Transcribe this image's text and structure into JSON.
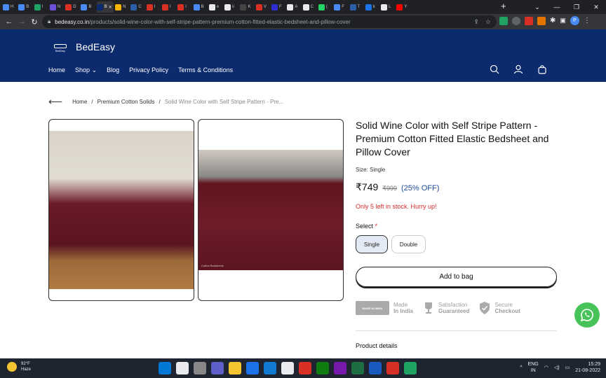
{
  "browser": {
    "tabs": [
      {
        "label": "H",
        "color": "#4a8af4"
      },
      {
        "label": "B",
        "color": "#4a8af4"
      },
      {
        "label": "I",
        "color": "#1ea362"
      },
      {
        "label": "N",
        "color": "#6b4fd8"
      },
      {
        "label": "D",
        "color": "#d93025"
      },
      {
        "label": "B",
        "color": "#4a8af4"
      },
      {
        "label": "B",
        "color": "#0c2a6e",
        "active": true
      },
      {
        "label": "N",
        "color": "#f4b400"
      },
      {
        "label": "C",
        "color": "#2c5fa8"
      },
      {
        "label": "I",
        "color": "#d93025"
      },
      {
        "label": "I",
        "color": "#d93025"
      },
      {
        "label": "I",
        "color": "#d93025"
      },
      {
        "label": "B",
        "color": "#4a8af4"
      },
      {
        "label": "e",
        "color": "#e8eaed"
      },
      {
        "label": "ii",
        "color": "#e8eaed"
      },
      {
        "label": "K",
        "color": "#444"
      },
      {
        "label": "V",
        "color": "#d93025"
      },
      {
        "label": "F",
        "color": "#2c2ccf"
      },
      {
        "label": "A",
        "color": "#e8eaed"
      },
      {
        "label": "C",
        "color": "#e8eaed"
      },
      {
        "label": "(",
        "color": "#25d366"
      },
      {
        "label": "F",
        "color": "#4a8af4"
      },
      {
        "label": "T",
        "color": "#2c5fa8"
      },
      {
        "label": "k",
        "color": "#1a73e8"
      },
      {
        "label": "L",
        "color": "#e8eaed"
      },
      {
        "label": "Y",
        "color": "#ff0000"
      }
    ],
    "new_tab": "+",
    "url_host": "bedeasy.co.in",
    "url_path": "/products/solid-wine-color-with-self-stripe-pattern-premium-cotton-fitted-elastic-bedsheet-and-pillow-cover",
    "profile_initial": "P"
  },
  "site": {
    "brand": "BedEasy",
    "brand_sub": "BedEasy",
    "nav": [
      "Home",
      "Shop",
      "Blog",
      "Privacy Policy",
      "Terms & Conditions"
    ]
  },
  "breadcrumb": {
    "home": "Home",
    "sep": "/",
    "category": "Premium Cotton Solids",
    "current": "Solid Wine Color with Self Stripe Pattern - Pre..."
  },
  "product": {
    "title": "Solid Wine Color with Self Stripe Pattern - Premium Cotton Fitted Elastic Bedsheet and Pillow Cover",
    "size_label": "Size: Single",
    "price": "₹749",
    "mrp": "₹999",
    "discount": "(25% OFF)",
    "stock_note": "Only 5 left in stock. Hurry up!",
    "select_label": "Select",
    "select_required": "*",
    "options": [
      "Single",
      "Double"
    ],
    "selected_option": "Single",
    "add_to_bag": "Add to bag",
    "image_watermark": "Cotton Bedsheets",
    "badges": [
      {
        "line1": "Made",
        "line2": "In India",
        "logo_text": "MADE IN INDIA"
      },
      {
        "line1": "Satisfaction",
        "line2": "Guaranteed"
      },
      {
        "line1": "Secure",
        "line2": "Checkout"
      }
    ],
    "details_heading": "Product details"
  },
  "taskbar": {
    "temp": "92°F",
    "weather": "Haze",
    "lang1": "ENG",
    "lang2": "IN",
    "time": "15:29",
    "date": "21-08-2022",
    "app_colors": [
      "#0078d4",
      "#e8eaed",
      "#888",
      "#5b5fc7",
      "#f4c430",
      "#1a73e8",
      "#0f7ad0",
      "#e8eaed",
      "#d93025",
      "#107c10",
      "#7719aa",
      "#1d6f42",
      "#185abd",
      "#d93025",
      "#1ea362"
    ]
  },
  "colors": {
    "header_bg": "#0c2a6e",
    "accent_blue": "#1c4a98",
    "stock_red": "#d12b2b",
    "wine": "#62141f",
    "whatsapp_green": "#47c35a"
  }
}
